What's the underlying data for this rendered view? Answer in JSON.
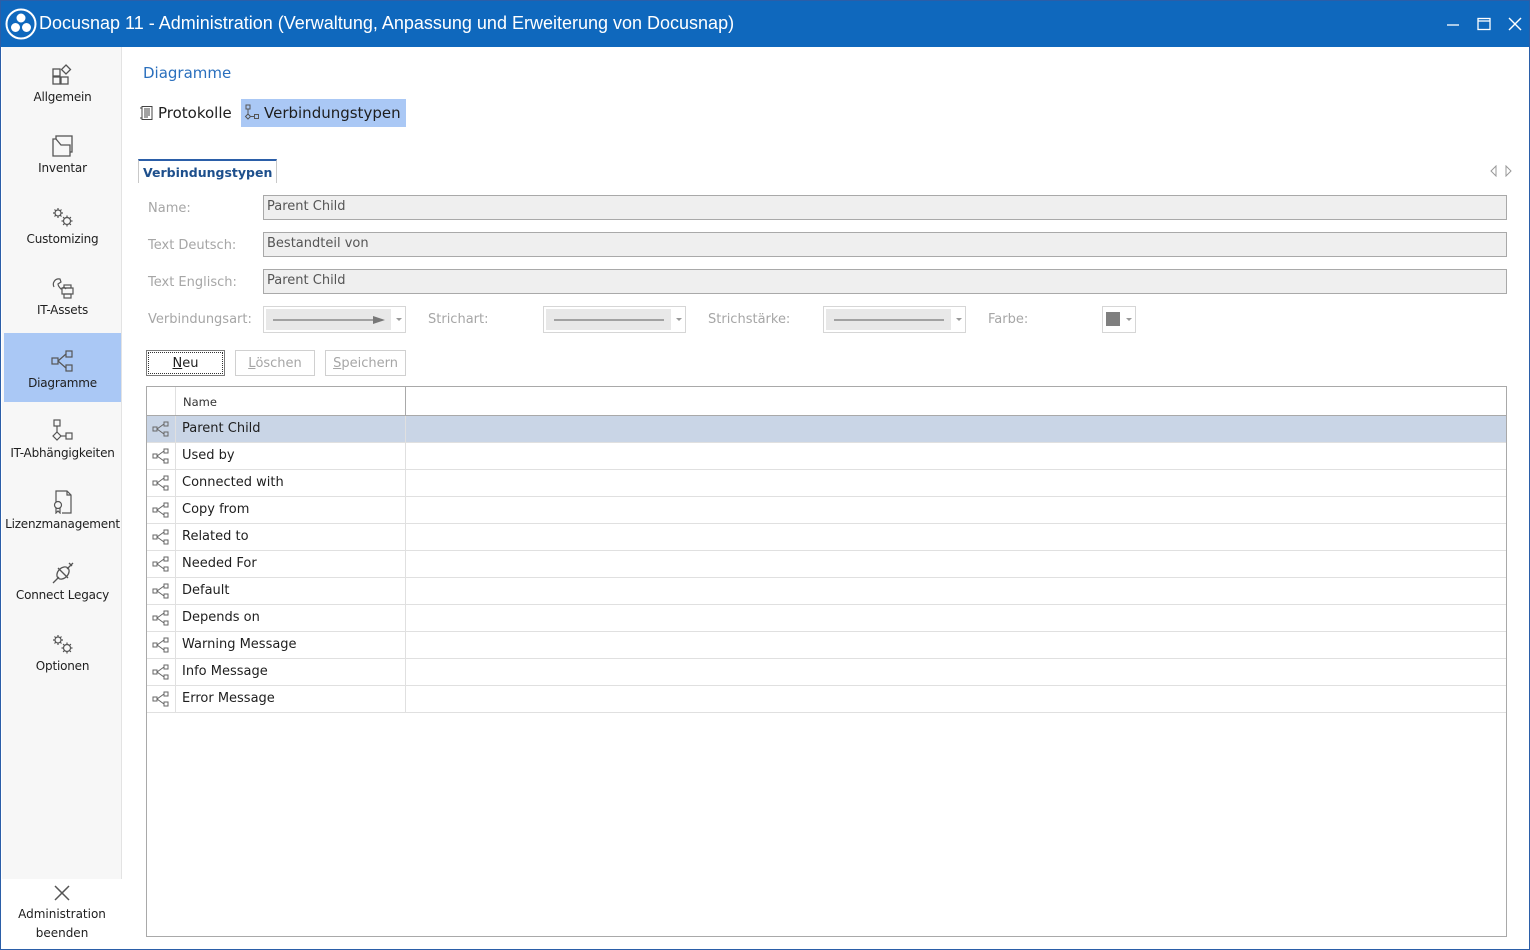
{
  "window": {
    "title": "Docusnap 11 - Administration (Verwaltung, Anpassung und Erweiterung von Docusnap)",
    "accent_color": "#0f68bd"
  },
  "sidebar": {
    "items": [
      {
        "label": "Allgemein",
        "icon": "general-icon",
        "active": false
      },
      {
        "label": "Inventar",
        "icon": "inventory-icon",
        "active": false
      },
      {
        "label": "Customizing",
        "icon": "gears-icon",
        "active": false
      },
      {
        "label": "IT-Assets",
        "icon": "it-assets-icon",
        "active": false
      },
      {
        "label": "Diagramme",
        "icon": "diagram-icon",
        "active": true
      },
      {
        "label": "IT-Abhängigkeiten",
        "icon": "dependencies-icon",
        "active": false
      },
      {
        "label": "Lizenzmanagement",
        "icon": "license-icon",
        "active": false
      },
      {
        "label": "Connect Legacy",
        "icon": "plug-icon",
        "active": false
      },
      {
        "label": "Optionen",
        "icon": "gears-icon",
        "active": false
      }
    ],
    "exit": {
      "line1": "Administration",
      "line2": "beenden",
      "icon": "close-icon"
    },
    "active_color": "#aac8f5"
  },
  "main": {
    "section_title": "Diagramme",
    "subtabs": [
      {
        "label": "Protokolle",
        "icon": "log-icon",
        "active": false
      },
      {
        "label": "Verbindungstypen",
        "icon": "connection-type-icon",
        "active": true
      }
    ],
    "doc_tab": "Verbindungstypen",
    "form": {
      "name_label": "Name:",
      "name_value": "Parent Child",
      "text_de_label": "Text Deutsch:",
      "text_de_value": "Bestandteil von",
      "text_en_label": "Text Englisch:",
      "text_en_value": "Parent Child",
      "connection_type_label": "Verbindungsart:",
      "connection_type_value": "arrow-line",
      "line_style_label": "Strichart:",
      "line_style_value": "solid",
      "line_width_label": "Strichstärke:",
      "line_width_value": "medium",
      "color_label": "Farbe:",
      "color_value": "#7f7f7f"
    },
    "buttons": {
      "new_mnemonic": "N",
      "new_rest": "eu",
      "delete_mnemonic": "L",
      "delete_rest": "öschen",
      "save_mnemonic": "S",
      "save_rest": "peichern"
    },
    "grid": {
      "column_header": "Name",
      "rows": [
        {
          "name": "Parent Child",
          "selected": true
        },
        {
          "name": "Used by",
          "selected": false
        },
        {
          "name": "Connected with",
          "selected": false
        },
        {
          "name": "Copy from",
          "selected": false
        },
        {
          "name": "Related to",
          "selected": false
        },
        {
          "name": "Needed For",
          "selected": false
        },
        {
          "name": "Default",
          "selected": false
        },
        {
          "name": "Depends on",
          "selected": false
        },
        {
          "name": "Warning Message",
          "selected": false
        },
        {
          "name": "Info Message",
          "selected": false
        },
        {
          "name": "Error Message",
          "selected": false
        }
      ]
    }
  }
}
